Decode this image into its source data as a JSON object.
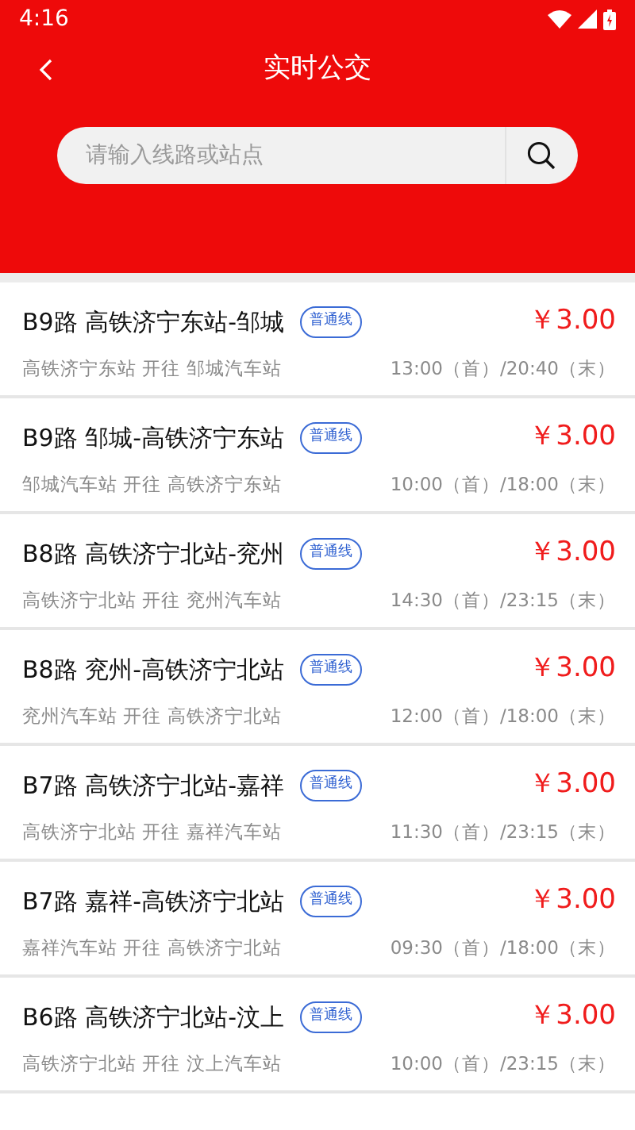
{
  "status_bar": {
    "time": "4:16"
  },
  "header": {
    "title": "实时公交"
  },
  "search": {
    "placeholder": "请输入线路或站点"
  },
  "routes": [
    {
      "name": "B9路 高铁济宁东站-邹城",
      "tag": "普通线",
      "price": "￥3.00",
      "direction": "高铁济宁东站 开往 邹城汽车站",
      "schedule": "13:00（首）/20:40（末）"
    },
    {
      "name": "B9路 邹城-高铁济宁东站",
      "tag": "普通线",
      "price": "￥3.00",
      "direction": "邹城汽车站 开往 高铁济宁东站",
      "schedule": "10:00（首）/18:00（末）"
    },
    {
      "name": "B8路 高铁济宁北站-兖州",
      "tag": "普通线",
      "price": "￥3.00",
      "direction": "高铁济宁北站 开往 兖州汽车站",
      "schedule": "14:30（首）/23:15（末）"
    },
    {
      "name": "B8路 兖州-高铁济宁北站",
      "tag": "普通线",
      "price": "￥3.00",
      "direction": "兖州汽车站 开往 高铁济宁北站",
      "schedule": "12:00（首）/18:00（末）"
    },
    {
      "name": "B7路 高铁济宁北站-嘉祥",
      "tag": "普通线",
      "price": "￥3.00",
      "direction": "高铁济宁北站 开往 嘉祥汽车站",
      "schedule": "11:30（首）/23:15（末）"
    },
    {
      "name": "B7路 嘉祥-高铁济宁北站",
      "tag": "普通线",
      "price": "￥3.00",
      "direction": "嘉祥汽车站 开往 高铁济宁北站",
      "schedule": "09:30（首）/18:00（末）"
    },
    {
      "name": "B6路 高铁济宁北站-汶上",
      "tag": "普通线",
      "price": "￥3.00",
      "direction": "高铁济宁北站 开往 汶上汽车站",
      "schedule": "10:00（首）/23:15（末）"
    }
  ]
}
